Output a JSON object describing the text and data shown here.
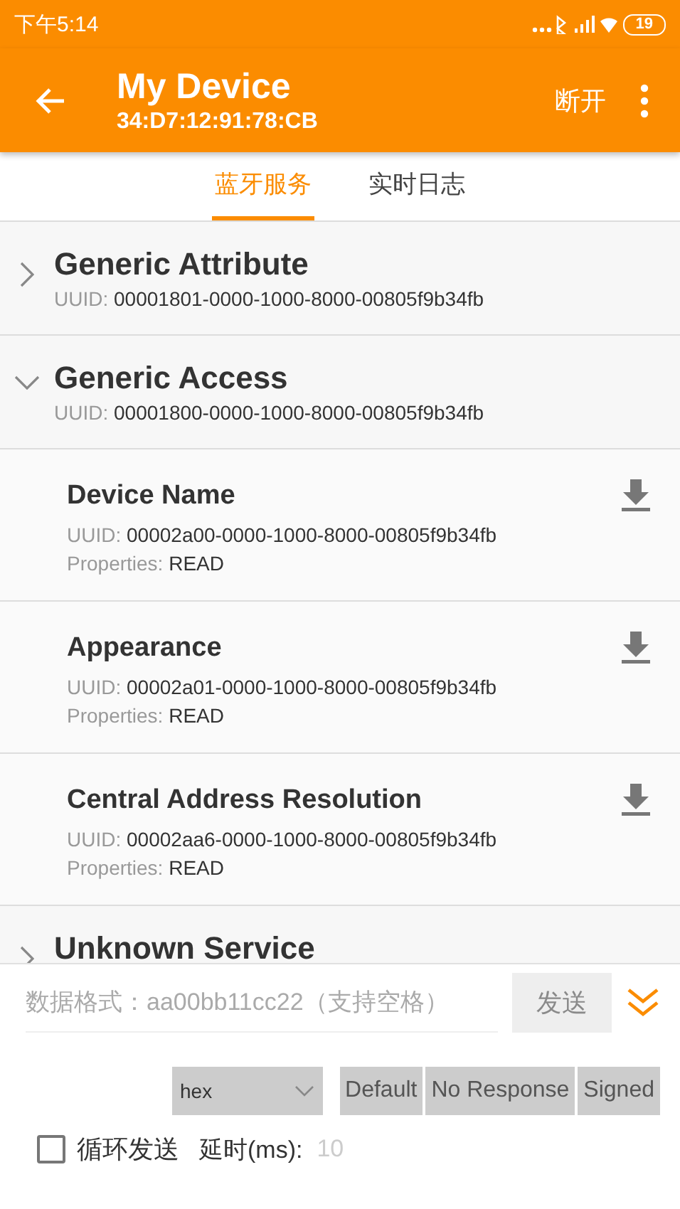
{
  "status_bar": {
    "time": "下午5:14",
    "battery": "19"
  },
  "app_bar": {
    "title": "My Device",
    "subtitle": "34:D7:12:91:78:CB",
    "action": "断开"
  },
  "tabs": [
    {
      "label": "蓝牙服务",
      "selected": true
    },
    {
      "label": "实时日志",
      "selected": false
    }
  ],
  "services": [
    {
      "name": "Generic Attribute",
      "uuid_label": "UUID:",
      "uuid": "00001801-0000-1000-8000-00805f9b34fb",
      "expanded": false
    },
    {
      "name": "Generic Access",
      "uuid_label": "UUID:",
      "uuid": "00001800-0000-1000-8000-00805f9b34fb",
      "expanded": true,
      "characteristics": [
        {
          "name": "Device Name",
          "uuid_label": "UUID:",
          "uuid": "00002a00-0000-1000-8000-00805f9b34fb",
          "properties_label": "Properties:",
          "properties": "READ"
        },
        {
          "name": "Appearance",
          "uuid_label": "UUID:",
          "uuid": "00002a01-0000-1000-8000-00805f9b34fb",
          "properties_label": "Properties:",
          "properties": "READ"
        },
        {
          "name": "Central Address Resolution",
          "uuid_label": "UUID:",
          "uuid": "00002aa6-0000-1000-8000-00805f9b34fb",
          "properties_label": "Properties:",
          "properties": "READ"
        }
      ]
    },
    {
      "name": "Unknown Service",
      "expanded": false
    }
  ],
  "send_panel": {
    "data_placeholder": "数据格式：aa00bb11cc22（支持空格）",
    "send_button": "发送",
    "format": "hex",
    "write_types": [
      "Default",
      "No Response",
      "Signed"
    ],
    "loop": {
      "label": "循环发送",
      "checked": false
    },
    "delay_label": "延时(ms):",
    "delay_placeholder": "10"
  }
}
